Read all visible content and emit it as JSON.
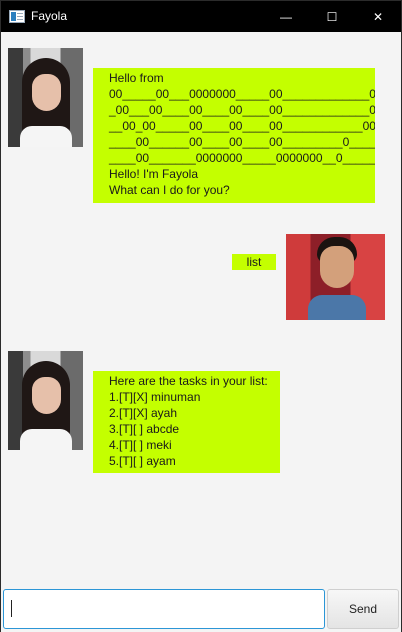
{
  "window": {
    "title": "Fayola",
    "controls": {
      "minimize": "—",
      "maximize": "☐",
      "close": "✕"
    }
  },
  "messages": [
    {
      "sender": "bot",
      "avatar": "avatar-girl",
      "text": "Hello from\n00_____00___0000000_____00_____________0______\n_00___00____00____00____00_____________0_0_____\n__00_00_____00____00____00____________0000____\n____00______00____00____00_________0_____0__\n____00_______0000000_____0000000__0_______0_\nHello! I'm Fayola\nWhat can I do for you?"
    },
    {
      "sender": "user",
      "avatar": "avatar-boy",
      "text": "list"
    },
    {
      "sender": "bot",
      "avatar": "avatar-girl",
      "text": "Here are the tasks in your list:\n1.[T][X] minuman\n2.[T][X] ayah\n3.[T][ ] abcde\n4.[T][ ] meki\n5.[T][ ] ayam"
    }
  ],
  "input": {
    "value": "",
    "placeholder": ""
  },
  "send_label": "Send",
  "colors": {
    "bubble": "#c4ff00",
    "titlebar": "#000000",
    "background": "#f4f4f4",
    "input_focus": "#2c96d6"
  }
}
